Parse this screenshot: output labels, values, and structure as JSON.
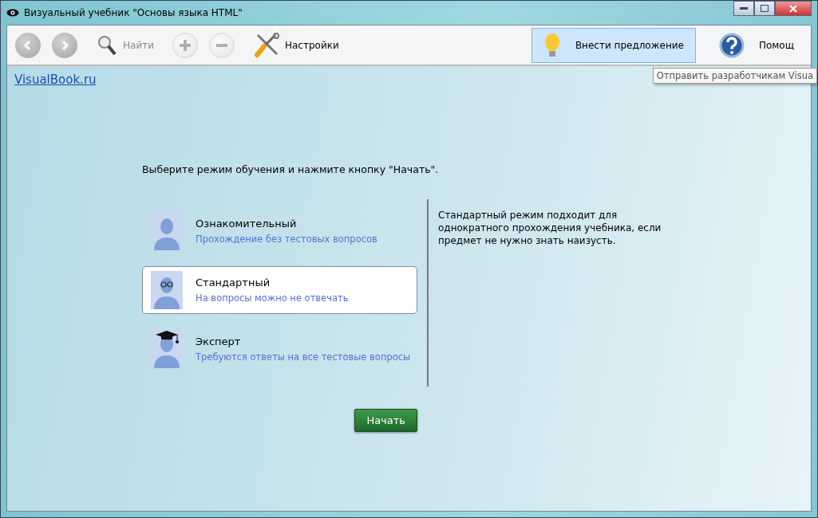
{
  "window": {
    "title": "Визуальный учебник \"Основы языка HTML\""
  },
  "toolbar": {
    "items": [
      {
        "kind": "back",
        "disabled": true
      },
      {
        "kind": "forward",
        "disabled": true
      },
      {
        "kind": "search",
        "label": "Найти",
        "disabled": true
      },
      {
        "kind": "plus",
        "disabled": true
      },
      {
        "kind": "minus",
        "disabled": true
      },
      {
        "kind": "settings",
        "label": "Настройки",
        "disabled": false
      }
    ],
    "right_items": [
      {
        "kind": "suggest",
        "label": "Внести предложение",
        "hovered": true
      },
      {
        "kind": "help",
        "label": "Помощ",
        "hovered": false
      }
    ]
  },
  "tooltip": "Отправить разработчикам Visua",
  "site_link": "VisualBook.ru",
  "prompt": "Выберите режим обучения и нажмите кнопку \"Начать\".",
  "modes": [
    {
      "kind": "plain",
      "title": "Ознакомительный",
      "subtitle": "Прохождение без тестовых вопросов",
      "selected": false
    },
    {
      "kind": "glasses",
      "title": "Стандартный",
      "subtitle": "На вопросы можно не отвечать",
      "selected": true
    },
    {
      "kind": "cap",
      "title": "Эксперт",
      "subtitle": "Требуются ответы на все тестовые вопросы",
      "selected": false
    }
  ],
  "description": "Стандартный режим подходит для однократного прохождения учебника, если предмет не нужно знать наизусть.",
  "start_button": "Начать"
}
